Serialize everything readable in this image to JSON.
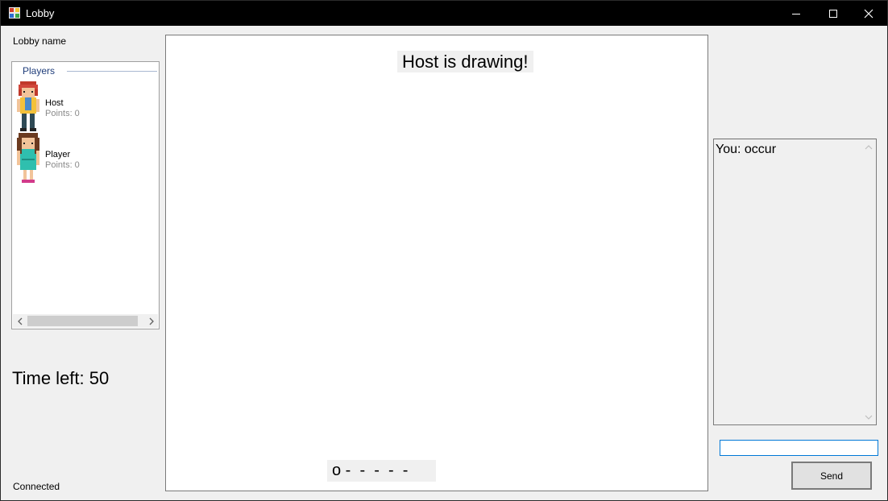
{
  "window": {
    "title": "Lobby"
  },
  "lobby": {
    "name_label": "Lobby name",
    "connection_status": "Connected"
  },
  "players": {
    "group_label": "Players",
    "items": [
      {
        "name": "Host",
        "points": "Points: 0",
        "avatar": "red-haired-boy-avatar"
      },
      {
        "name": "Player",
        "points": "Points: 0",
        "avatar": "brown-haired-girl-avatar"
      }
    ]
  },
  "timer": {
    "label": "Time left: 50"
  },
  "canvas": {
    "status": "Host is drawing!",
    "word_hint": "o -  -  -  -  -"
  },
  "chat": {
    "messages": [
      "You: occur"
    ],
    "input_value": "",
    "send_label": "Send"
  },
  "colors": {
    "focus": "#0078d7",
    "titlebar": "#000000",
    "panel": "#f0f0f0"
  }
}
